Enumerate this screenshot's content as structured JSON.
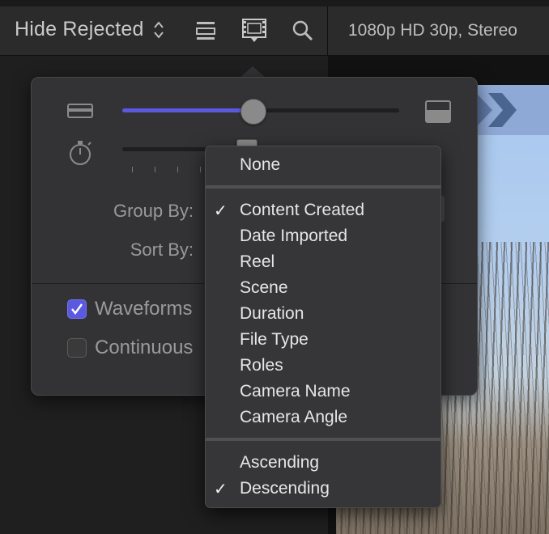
{
  "toolbar": {
    "filter_label": "Hide Rejected",
    "format_text": "1080p HD 30p, Stereo",
    "icons": [
      "clip-appearance-icon",
      "filmstrip-icon",
      "search-icon"
    ]
  },
  "popover": {
    "clip_height_slider": {
      "value_percent": 47
    },
    "duration_slider": {
      "value_percent": 46
    },
    "group_by_label": "Group By:",
    "sort_by_label": "Sort By:",
    "waveforms": {
      "label": "Waveforms",
      "checked": true
    },
    "continuous": {
      "label": "Continuous",
      "checked": false
    }
  },
  "menu": {
    "items_top": [
      {
        "label": "None",
        "checked": false
      }
    ],
    "items_group": [
      {
        "label": "Content Created",
        "checked": true
      },
      {
        "label": "Date Imported",
        "checked": false
      },
      {
        "label": "Reel",
        "checked": false
      },
      {
        "label": "Scene",
        "checked": false
      },
      {
        "label": "Duration",
        "checked": false
      },
      {
        "label": "File Type",
        "checked": false
      },
      {
        "label": "Roles",
        "checked": false
      },
      {
        "label": "Camera Name",
        "checked": false
      },
      {
        "label": "Camera Angle",
        "checked": false
      }
    ],
    "items_order": [
      {
        "label": "Ascending",
        "checked": false
      },
      {
        "label": "Descending",
        "checked": true
      }
    ],
    "check_glyph": "✓"
  },
  "colors": {
    "accent": "#5b59e0",
    "popover_bg": "#333335",
    "menu_bg": "#363638"
  }
}
